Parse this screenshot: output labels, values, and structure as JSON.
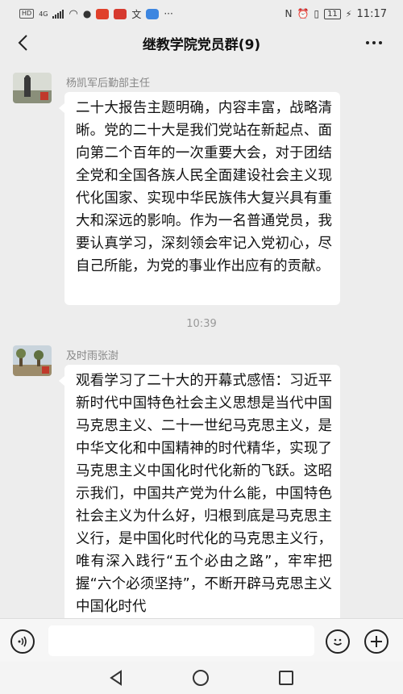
{
  "status_bar": {
    "left_badge": "HD",
    "network": "4G",
    "right_battery": "11",
    "time": "11:17"
  },
  "nav": {
    "title": "继教学院党员群(9)"
  },
  "messages": [
    {
      "sender": "杨凯军后勤部主任",
      "text": "二十大报告主题明确，内容丰富，战略清晰。党的二十大是我们党站在新起点、面向第二个百年的一次重要大会，对于团结全党和全国各族人民全面建设社会主义现代化国家、实现中华民族伟大复兴具有重大和深远的影响。作为一名普通党员，我要认真学习，深刻领会牢记入党初心，尽自己所能，为党的事业作出应有的贡献。"
    },
    {
      "sender": "及时雨张澍",
      "text": "观看学习了二十大的开幕式感悟：习近平新时代中国特色社会主义思想是当代中国马克思主义、二十一世纪马克思主义，是中华文化和中国精神的时代精华，实现了马克思主义中国化时代化新的飞跃。这昭示我们，中国共产党为什么能，中国特色社会主义为什么好，归根到底是马克思主义行，是中国化时代化的马克思主义行，唯有深入践行“五个必由之路”，牢牢把握“六个必须坚持”，不断开辟马克思主义中国化时代"
    }
  ],
  "timestamp": "10:39",
  "icons": {
    "back": "back-arrow-icon",
    "more": "more-dots-icon",
    "voice": "voice-icon",
    "emoji": "emoji-icon",
    "plus": "plus-icon"
  }
}
